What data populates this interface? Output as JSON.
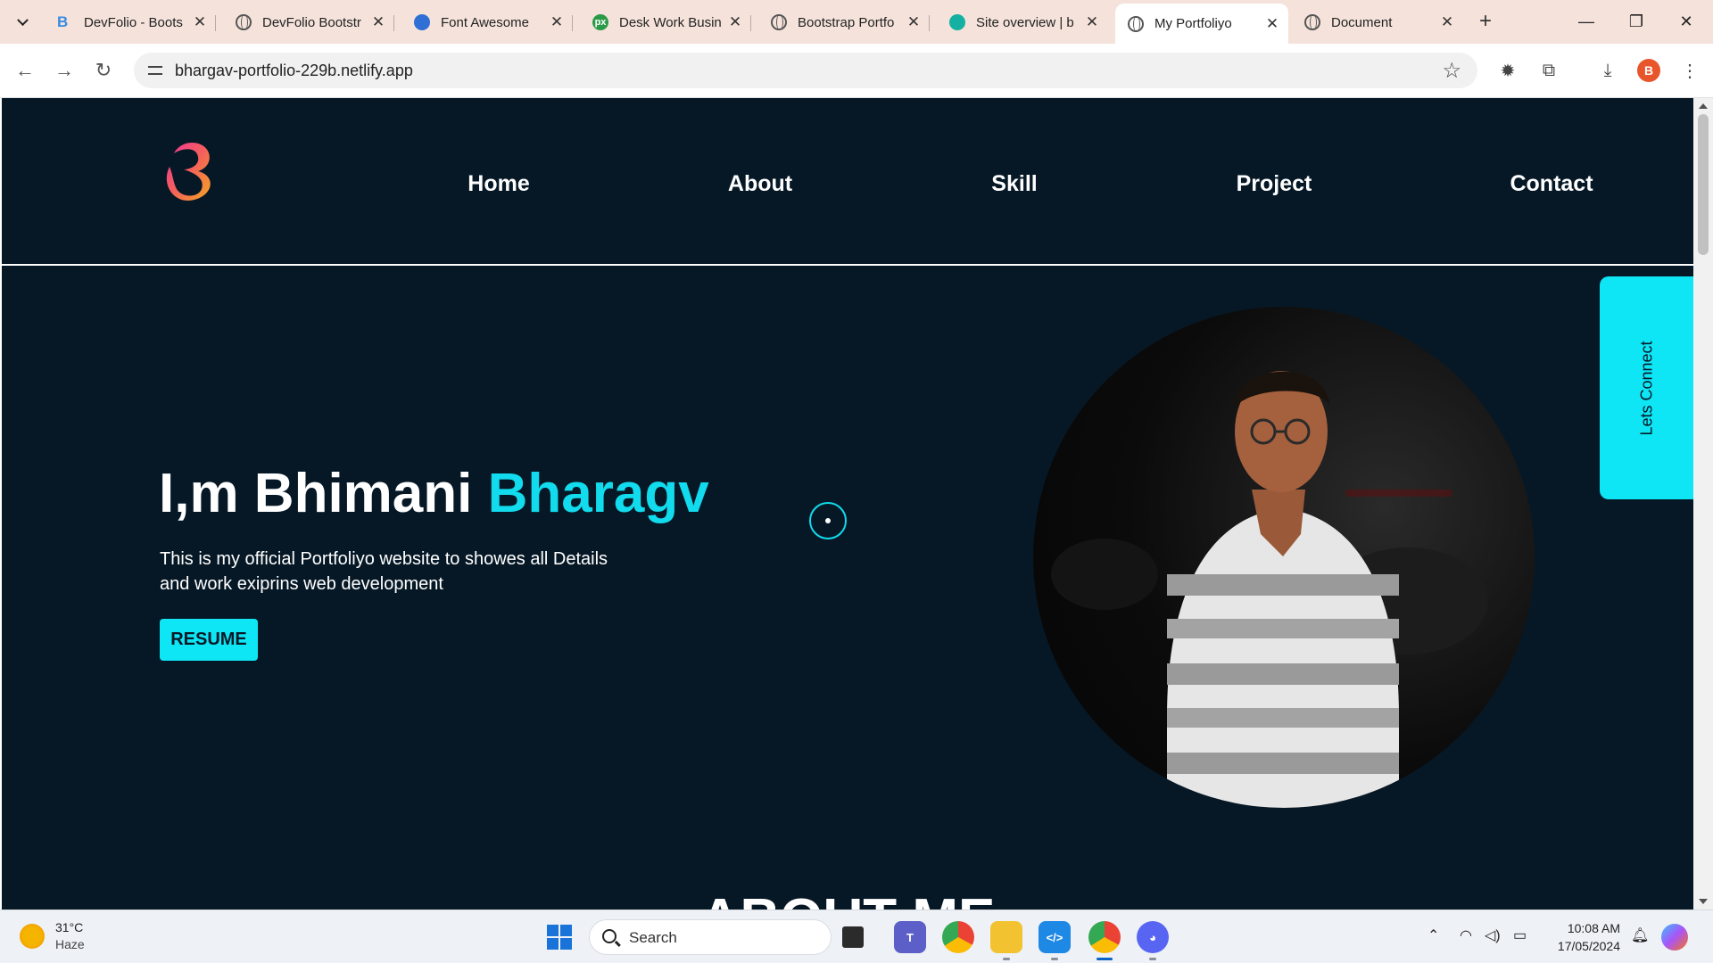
{
  "browser": {
    "tabs": [
      {
        "title": "DevFolio - Boots",
        "favicon": "devfolio-icon",
        "active": false
      },
      {
        "title": "DevFolio Bootstr",
        "favicon": "globe-icon",
        "active": false
      },
      {
        "title": "Font Awesome",
        "favicon": "flag-icon",
        "active": false
      },
      {
        "title": "Desk Work Busin",
        "favicon": "px-icon",
        "active": false
      },
      {
        "title": "Bootstrap Portfo",
        "favicon": "globe-icon",
        "active": false
      },
      {
        "title": "Site overview | b",
        "favicon": "diamond-icon",
        "active": false
      },
      {
        "title": "My Portfoliyo",
        "favicon": "globe-icon",
        "active": true
      },
      {
        "title": "Document",
        "favicon": "globe-icon",
        "active": false
      }
    ],
    "url": "bhargav-portfolio-229b.netlify.app",
    "profile_initial": "B"
  },
  "site": {
    "nav": {
      "home": "Home",
      "about": "About",
      "skill": "Skill",
      "project": "Project",
      "contact": "Contact"
    },
    "hero": {
      "title_prefix": "I,m Bhimani ",
      "title_accent": "Bharagv",
      "description": "This is my official Portfoliyo website to showes all Details and work exiprins web development",
      "resume_label": "RESUME"
    },
    "lets_connect": "Lets Connect",
    "about_heading": "ABOUT ME",
    "colors": {
      "background": "#061826",
      "accent": "#0ee6f5"
    }
  },
  "taskbar": {
    "weather_temp": "31°C",
    "weather_condition": "Haze",
    "search_label": "Search",
    "time": "10:08 AM",
    "date": "17/05/2024"
  }
}
